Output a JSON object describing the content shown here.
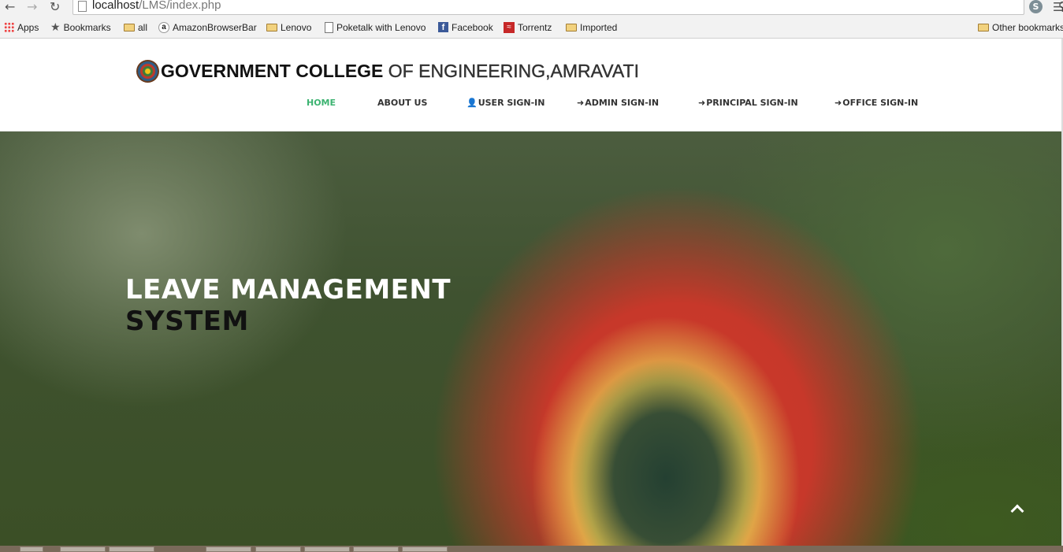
{
  "browser": {
    "url_host": "localhost",
    "url_path": "/LMS/index.php",
    "bookmarks": [
      {
        "label": "Apps",
        "icon": "apps-icon"
      },
      {
        "label": "Bookmarks",
        "icon": "star-icon"
      },
      {
        "label": "all",
        "icon": "folder-icon"
      },
      {
        "label": "AmazonBrowserBar",
        "icon": "amazon-icon",
        "glyph": "a"
      },
      {
        "label": "Lenovo",
        "icon": "folder-icon"
      },
      {
        "label": "Poketalk with Lenovo",
        "icon": "page-icon"
      },
      {
        "label": "Facebook",
        "icon": "facebook-icon",
        "glyph": "f"
      },
      {
        "label": "Torrentz",
        "icon": "torrentz-icon"
      },
      {
        "label": "Imported",
        "icon": "folder-icon"
      }
    ],
    "other_bookmarks": "Other bookmarks"
  },
  "site": {
    "brand_part1": "GOVERNMENT COLLEGE",
    "brand_part2": " OF ENGINEERING,AMRAVATI",
    "nav": [
      {
        "label": "HOME",
        "active": true
      },
      {
        "label": "ABOUT US"
      },
      {
        "label": "USER SIGN-IN",
        "icon": "user-icon"
      },
      {
        "label": "ADMIN SIGN-IN",
        "icon": "sign-in-icon"
      },
      {
        "label": "PRINCIPAL SIGN-IN",
        "icon": "sign-in-icon"
      },
      {
        "label": "OFFICE SIGN-IN",
        "icon": "sign-in-icon"
      }
    ]
  },
  "hero": {
    "line1": "LEAVE MANAGEMENT",
    "line2": "SYSTEM"
  },
  "colors": {
    "nav_active": "#3cb371",
    "hero_line1": "#ffffff",
    "hero_line2": "#111111"
  }
}
